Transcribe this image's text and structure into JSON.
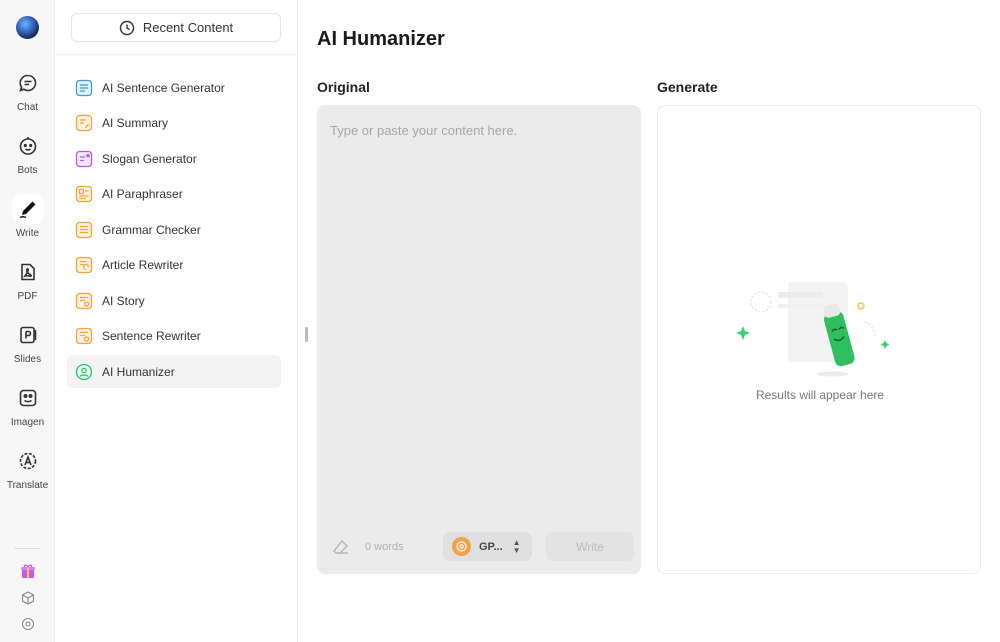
{
  "app": {
    "title": "AI Humanizer"
  },
  "rail": {
    "items": [
      {
        "label": "Chat",
        "icon": "chat-icon"
      },
      {
        "label": "Bots",
        "icon": "bot-icon"
      },
      {
        "label": "Write",
        "icon": "pen-icon",
        "active": true
      },
      {
        "label": "PDF",
        "icon": "pdf-icon"
      },
      {
        "label": "Slides",
        "icon": "slides-icon"
      },
      {
        "label": "Imagen",
        "icon": "image-icon"
      },
      {
        "label": "Translate",
        "icon": "translate-icon"
      }
    ],
    "bottom": [
      "gift-icon",
      "cube-icon",
      "settings-icon"
    ]
  },
  "sidebar": {
    "recent_label": "Recent Content",
    "tools": [
      {
        "label": "AI Sentence Generator",
        "icon": "sentence-generator-icon",
        "color": "#3d9be9"
      },
      {
        "label": "AI Summary",
        "icon": "summary-icon",
        "color": "#f0a43c"
      },
      {
        "label": "Slogan Generator",
        "icon": "slogan-icon",
        "color": "#b05ee0"
      },
      {
        "label": "AI Paraphraser",
        "icon": "paraphraser-icon",
        "color": "#f0a43c"
      },
      {
        "label": "Grammar Checker",
        "icon": "grammar-icon",
        "color": "#f0a43c"
      },
      {
        "label": "Article Rewriter",
        "icon": "rewriter-icon",
        "color": "#f0a43c"
      },
      {
        "label": "AI Story",
        "icon": "story-icon",
        "color": "#f0a43c"
      },
      {
        "label": "Sentence Rewriter",
        "icon": "sentence-rewriter-icon",
        "color": "#f0a43c"
      },
      {
        "label": "AI Humanizer",
        "icon": "humanizer-icon",
        "color": "#2dbf6a",
        "active": true
      }
    ]
  },
  "main": {
    "original_label": "Original",
    "generate_label": "Generate",
    "input_placeholder": "Type or paste your content here.",
    "word_count": "0 words",
    "model": "GP...",
    "write_label": "Write",
    "empty_text": "Results will appear here"
  },
  "colors": {
    "accent_green": "#2dbf6a",
    "input_bg": "#ebebeb"
  }
}
